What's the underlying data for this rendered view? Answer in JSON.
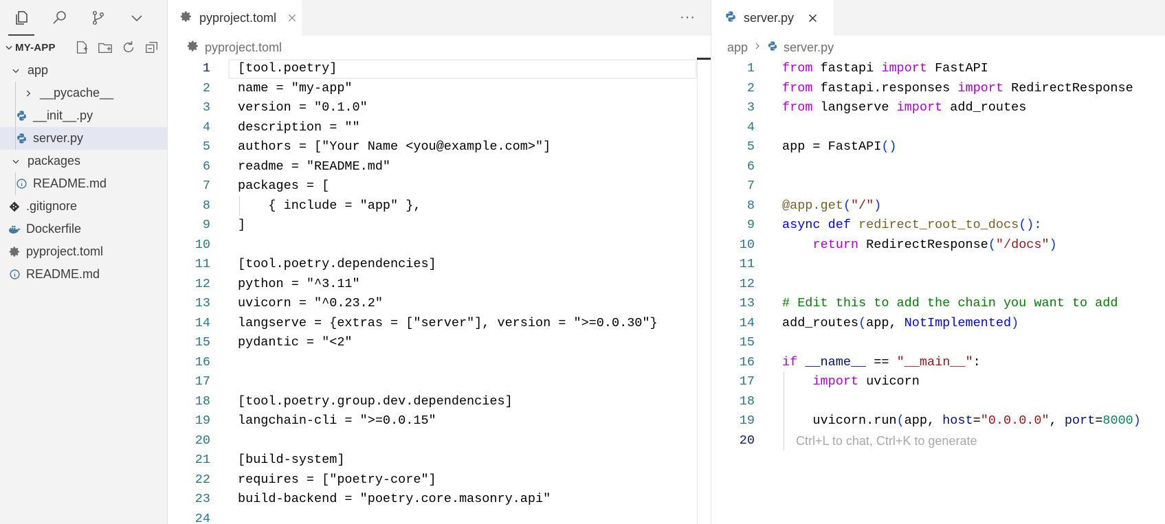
{
  "sidebar": {
    "activity": [
      "explorer-icon",
      "search-icon",
      "source-control-icon",
      "chevron-down-icon"
    ],
    "section_title": "MY-APP",
    "tree": [
      {
        "label": "app",
        "kind": "folder-open",
        "depth": 1
      },
      {
        "label": "__pycache__",
        "kind": "folder-closed",
        "depth": 2
      },
      {
        "label": "__init__.py",
        "kind": "python",
        "depth": 2
      },
      {
        "label": "server.py",
        "kind": "python",
        "depth": 2,
        "selected": true
      },
      {
        "label": "packages",
        "kind": "folder-open",
        "depth": 1
      },
      {
        "label": "README.md",
        "kind": "info",
        "depth": 2
      },
      {
        "label": ".gitignore",
        "kind": "git",
        "depth": 1
      },
      {
        "label": "Dockerfile",
        "kind": "docker",
        "depth": 1
      },
      {
        "label": "pyproject.toml",
        "kind": "gear",
        "depth": 1
      },
      {
        "label": "README.md",
        "kind": "info",
        "depth": 1
      }
    ]
  },
  "left_editor": {
    "tab_label": "pyproject.toml",
    "more_label": "···",
    "breadcrumb": [
      "pyproject.toml"
    ],
    "current_line": 1,
    "lines": [
      [
        {
          "t": "[tool.poetry]"
        }
      ],
      [
        {
          "t": "name = \"my-app\""
        }
      ],
      [
        {
          "t": "version = \"0.1.0\""
        }
      ],
      [
        {
          "t": "description = \"\""
        }
      ],
      [
        {
          "t": "authors = [\"Your Name <you@example.com>\"]"
        }
      ],
      [
        {
          "t": "readme = \"README.md\""
        }
      ],
      [
        {
          "t": "packages = ["
        }
      ],
      [
        {
          "t": "    { include = \"app\" },"
        }
      ],
      [
        {
          "t": "]"
        }
      ],
      [],
      [
        {
          "t": "[tool.poetry.dependencies]"
        }
      ],
      [
        {
          "t": "python = \"^3.11\""
        }
      ],
      [
        {
          "t": "uvicorn = \"^0.23.2\""
        }
      ],
      [
        {
          "t": "langserve = {extras = [\"server\"], version = \">=0.0.30\"}"
        }
      ],
      [
        {
          "t": "pydantic = \"<2\""
        }
      ],
      [],
      [],
      [
        {
          "t": "[tool.poetry.group.dev.dependencies]"
        }
      ],
      [
        {
          "t": "langchain-cli = \">=0.0.15\""
        }
      ],
      [],
      [
        {
          "t": "[build-system]"
        }
      ],
      [
        {
          "t": "requires = [\"poetry-core\"]"
        }
      ],
      [
        {
          "t": "build-backend = \"poetry.core.masonry.api\""
        }
      ],
      []
    ]
  },
  "right_editor": {
    "tab_label": "server.py",
    "breadcrumb": [
      "app",
      "server.py"
    ],
    "current_line": 20,
    "ghost_hint": "Ctrl+L to chat, Ctrl+K to generate",
    "lines": [
      [
        {
          "t": "from",
          "c": "kw"
        },
        {
          "t": " fastapi "
        },
        {
          "t": "import",
          "c": "kw"
        },
        {
          "t": " FastAPI"
        }
      ],
      [
        {
          "t": "from",
          "c": "kw"
        },
        {
          "t": " fastapi.responses "
        },
        {
          "t": "import",
          "c": "kw"
        },
        {
          "t": " RedirectResponse"
        }
      ],
      [
        {
          "t": "from",
          "c": "kw"
        },
        {
          "t": " langserve "
        },
        {
          "t": "import",
          "c": "kw"
        },
        {
          "t": " add_routes"
        }
      ],
      [],
      [
        {
          "t": "app = FastAPI"
        },
        {
          "t": "()",
          "c": "par"
        }
      ],
      [],
      [],
      [
        {
          "t": "@app.get",
          "c": "dec"
        },
        {
          "t": "(",
          "c": "par"
        },
        {
          "t": "\"/\"",
          "c": "str"
        },
        {
          "t": ")",
          "c": "par"
        }
      ],
      [
        {
          "t": "async",
          "c": "kb"
        },
        {
          "t": " "
        },
        {
          "t": "def",
          "c": "kb"
        },
        {
          "t": " "
        },
        {
          "t": "redirect_root_to_docs",
          "c": "fn"
        },
        {
          "t": "():",
          "c": "par"
        }
      ],
      [
        {
          "t": "    "
        },
        {
          "t": "return",
          "c": "kw"
        },
        {
          "t": " RedirectResponse"
        },
        {
          "t": "(",
          "c": "par"
        },
        {
          "t": "\"/docs\"",
          "c": "str"
        },
        {
          "t": ")",
          "c": "par"
        }
      ],
      [],
      [],
      [
        {
          "t": "# Edit this to add the chain you want to add",
          "c": "cm"
        }
      ],
      [
        {
          "t": "add_routes"
        },
        {
          "t": "(",
          "c": "par"
        },
        {
          "t": "app, "
        },
        {
          "t": "NotImplemented",
          "c": "kb"
        },
        {
          "t": ")",
          "c": "par"
        }
      ],
      [],
      [
        {
          "t": "if",
          "c": "kw"
        },
        {
          "t": " "
        },
        {
          "t": "__name__",
          "c": "prm"
        },
        {
          "t": " == "
        },
        {
          "t": "\"__main__\"",
          "c": "str"
        },
        {
          "t": ":"
        }
      ],
      [
        {
          "t": "    "
        },
        {
          "t": "import",
          "c": "kw"
        },
        {
          "t": " uvicorn"
        }
      ],
      [],
      [
        {
          "t": "    uvicorn.run"
        },
        {
          "t": "(",
          "c": "par"
        },
        {
          "t": "app, "
        },
        {
          "t": "host",
          "c": "prm"
        },
        {
          "t": "="
        },
        {
          "t": "\"0.0.0.0\"",
          "c": "str"
        },
        {
          "t": ", "
        },
        {
          "t": "port",
          "c": "prm"
        },
        {
          "t": "="
        },
        {
          "t": "8000",
          "c": "num"
        },
        {
          "t": ")",
          "c": "par"
        }
      ],
      []
    ]
  }
}
